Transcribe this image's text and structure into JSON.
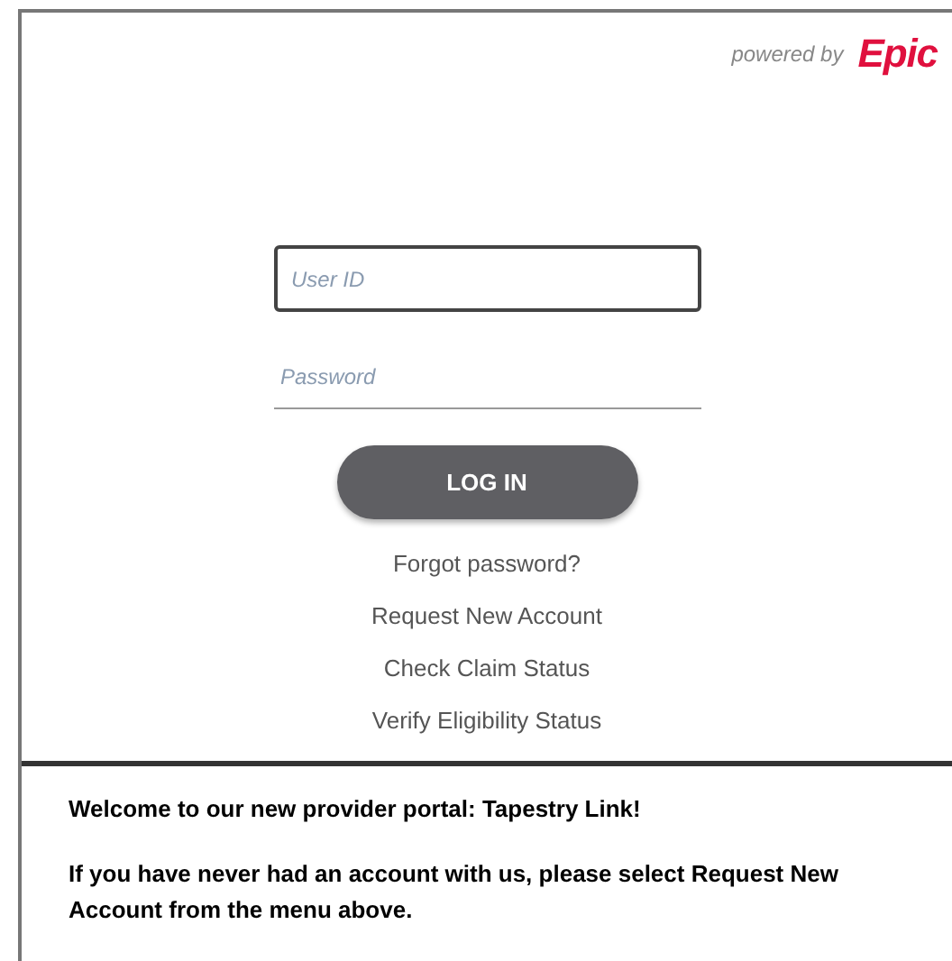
{
  "branding": {
    "powered_by": "powered by",
    "logo_text": "Epic"
  },
  "login_form": {
    "user_id": {
      "placeholder": "User ID",
      "focused": true
    },
    "password": {
      "placeholder": "Password"
    },
    "submit": "LOG IN"
  },
  "links": [
    "Forgot password?",
    "Request New Account",
    "Check Claim Status",
    "Verify Eligibility Status"
  ],
  "notice": {
    "heading": "Welcome to our new provider portal: Tapestry Link!",
    "body": "If you have never had an account with us, please select Request New Account from the menu above."
  }
}
